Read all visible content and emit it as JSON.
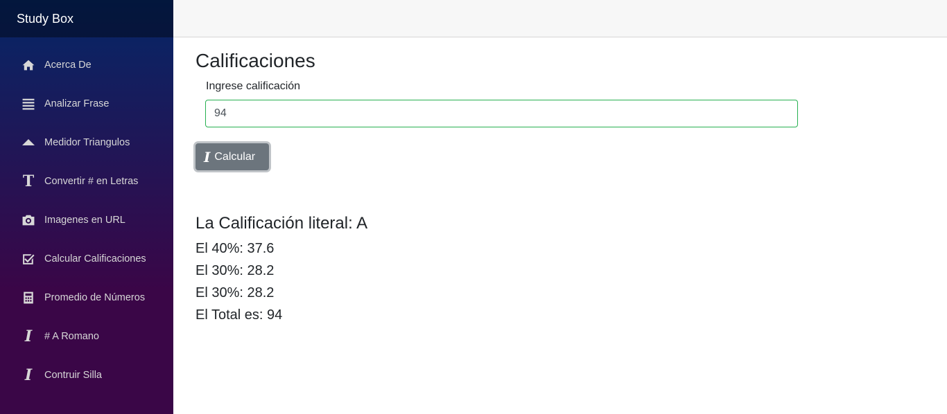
{
  "app": {
    "brand": "Study Box"
  },
  "sidebar": {
    "items": [
      {
        "label": "Acerca De",
        "icon": "home-icon"
      },
      {
        "label": "Analizar Frase",
        "icon": "list-icon"
      },
      {
        "label": "Medidor Triangulos",
        "icon": "triangle-up-icon"
      },
      {
        "label": "Convertir # en Letras",
        "icon": "text-icon"
      },
      {
        "label": "Imagenes en URL",
        "icon": "camera-icon"
      },
      {
        "label": "Calcular Calificaciones",
        "icon": "check-box-icon"
      },
      {
        "label": "Promedio de Números",
        "icon": "calculator-icon"
      },
      {
        "label": "# A Romano",
        "icon": "italic-icon"
      },
      {
        "label": "Contruir Silla",
        "icon": "italic-icon"
      }
    ]
  },
  "main": {
    "title": "Calificaciones",
    "input_label": "Ingrese calificación",
    "input_value": "94",
    "button_label": "Calcular",
    "results": {
      "literal": "La Calificación literal: A",
      "lines": [
        "El 40%: 37.6",
        "El 30%: 28.2",
        "El 30%: 28.2",
        "El Total es: 94"
      ]
    }
  },
  "colors": {
    "sidebar_top": "#052767",
    "sidebar_bottom": "#3a0647",
    "input_border": "#26b050",
    "button_bg": "#6c757d"
  }
}
